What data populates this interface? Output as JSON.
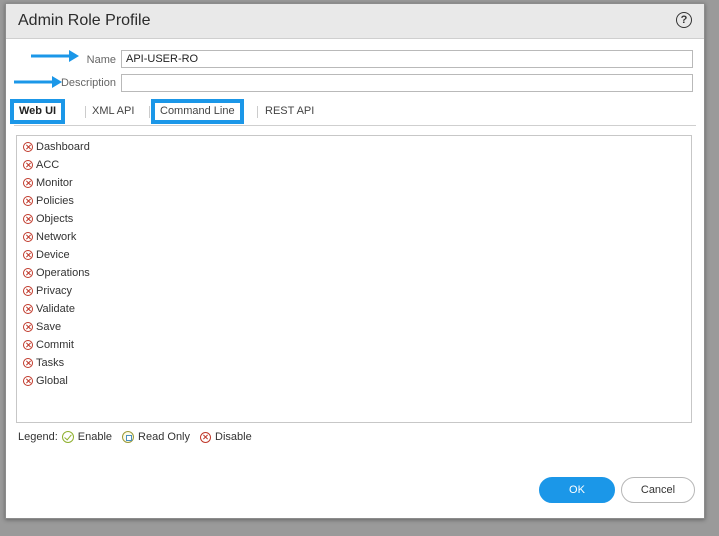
{
  "dialog": {
    "title": "Admin Role Profile",
    "help_icon": "question-circle-icon",
    "help_glyph": "?"
  },
  "form": {
    "name_label": "Name",
    "name_value": "API-USER-RO",
    "description_label": "Description",
    "description_value": ""
  },
  "tabs": [
    {
      "label": "Web UI",
      "active": true
    },
    {
      "label": "XML API",
      "active": false
    },
    {
      "label": "Command Line",
      "active": false
    },
    {
      "label": "REST API",
      "active": false
    }
  ],
  "permissions": [
    {
      "label": "Dashboard",
      "state": "disable"
    },
    {
      "label": "ACC",
      "state": "disable"
    },
    {
      "label": "Monitor",
      "state": "disable"
    },
    {
      "label": "Policies",
      "state": "disable"
    },
    {
      "label": "Objects",
      "state": "disable"
    },
    {
      "label": "Network",
      "state": "disable"
    },
    {
      "label": "Device",
      "state": "disable"
    },
    {
      "label": "Operations",
      "state": "disable"
    },
    {
      "label": "Privacy",
      "state": "disable"
    },
    {
      "label": "Validate",
      "state": "disable"
    },
    {
      "label": "Save",
      "state": "disable"
    },
    {
      "label": "Commit",
      "state": "disable"
    },
    {
      "label": "Tasks",
      "state": "disable"
    },
    {
      "label": "Global",
      "state": "disable"
    }
  ],
  "legend": {
    "label": "Legend:",
    "enable": "Enable",
    "read_only": "Read Only",
    "disable": "Disable"
  },
  "buttons": {
    "ok": "OK",
    "cancel": "Cancel"
  },
  "colors": {
    "accent": "#1b97e8",
    "disable": "#c0392b",
    "enable": "#8fb02f"
  }
}
